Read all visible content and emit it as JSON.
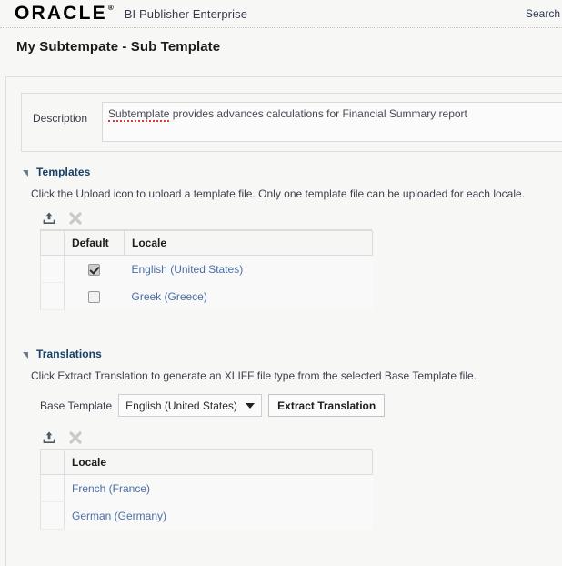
{
  "header": {
    "logo_text": "ORACLE",
    "logo_mark": "®",
    "app_name": "BI Publisher Enterprise",
    "search_label": "Search"
  },
  "page": {
    "title": "My Subtempate - Sub Template"
  },
  "description": {
    "label": "Description",
    "value_highlight": "Subtemplate",
    "value_rest": " provides advances calculations for Financial Summary report"
  },
  "templates_section": {
    "title": "Templates",
    "hint": "Click the Upload icon to upload a template file. Only one template file can be uploaded for each locale.",
    "toolbar": {
      "upload_title": "Upload",
      "delete_title": "Delete"
    },
    "columns": [
      "",
      "Default",
      "Locale"
    ],
    "rows": [
      {
        "checked": true,
        "locale": "English (United States)"
      },
      {
        "checked": false,
        "locale": "Greek (Greece)"
      }
    ]
  },
  "translations_section": {
    "title": "Translations",
    "hint": "Click Extract Translation to generate an XLIFF file type from the selected Base Template file.",
    "base_template_label": "Base Template",
    "base_template_value": "English (United States)",
    "extract_button": "Extract Translation",
    "toolbar": {
      "upload_title": "Upload",
      "delete_title": "Delete"
    },
    "columns": [
      "",
      "Locale"
    ],
    "rows": [
      {
        "locale": "French (France)"
      },
      {
        "locale": "German (Germany)"
      }
    ]
  },
  "colors": {
    "page_bg": "#f7f7f6",
    "section_title": "#14406b",
    "link": "#4a6fa5",
    "spellcheck_underline": "#d43b3b",
    "border": "#dcdcdc"
  }
}
